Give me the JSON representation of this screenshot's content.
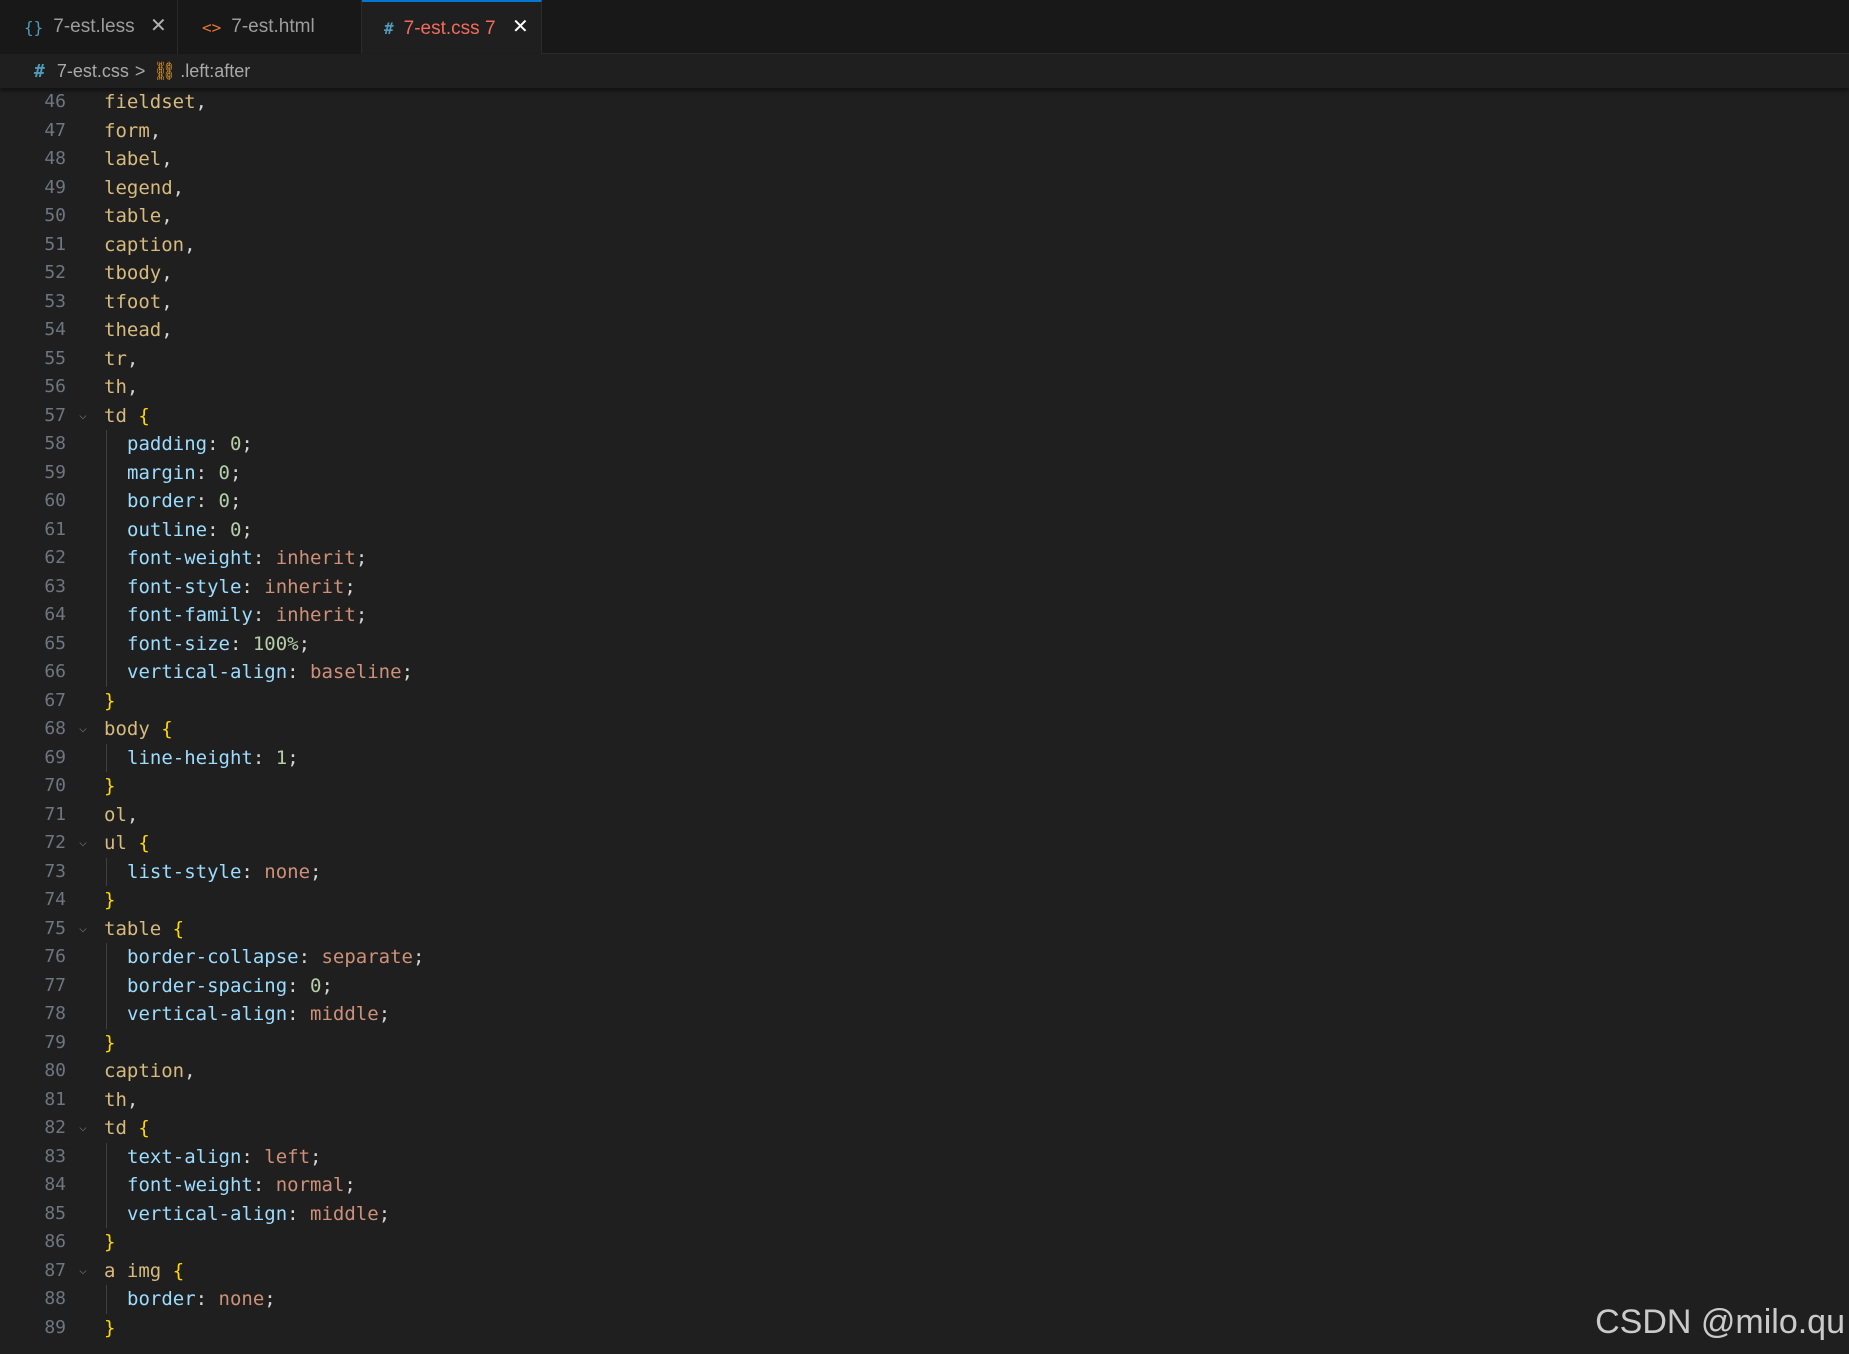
{
  "tabs": [
    {
      "icon": "{}",
      "label": "7-est.less",
      "close": "✕",
      "icon_color": "#519aba"
    },
    {
      "icon": "<>",
      "label": "7-est.html",
      "close": "",
      "icon_color": "#e37933"
    },
    {
      "icon": "#",
      "label": "7-est.css 7",
      "close": "✕",
      "icon_color": "#519aba",
      "active": true
    }
  ],
  "breadcrumb": {
    "file": "7-est.css",
    "hash": "#",
    "separator": ">",
    "symbol_icon": "⛓",
    "symbol": ".left:after"
  },
  "colors": {
    "selector": "#d7ba7d",
    "property": "#9cdcfe",
    "number": "#b5cea8",
    "keyword": "#ce9178",
    "brace": "#ffd700",
    "active_tab_text": "#f26b5b",
    "active_tab_border": "#0078d4"
  },
  "code_lines": [
    {
      "n": "46",
      "tokens": [
        [
          "sel",
          "fieldset"
        ],
        [
          "punct",
          ","
        ]
      ]
    },
    {
      "n": "47",
      "tokens": [
        [
          "sel",
          "form"
        ],
        [
          "punct",
          ","
        ]
      ]
    },
    {
      "n": "48",
      "tokens": [
        [
          "sel",
          "label"
        ],
        [
          "punct",
          ","
        ]
      ]
    },
    {
      "n": "49",
      "tokens": [
        [
          "sel",
          "legend"
        ],
        [
          "punct",
          ","
        ]
      ]
    },
    {
      "n": "50",
      "tokens": [
        [
          "sel",
          "table"
        ],
        [
          "punct",
          ","
        ]
      ]
    },
    {
      "n": "51",
      "tokens": [
        [
          "sel",
          "caption"
        ],
        [
          "punct",
          ","
        ]
      ]
    },
    {
      "n": "52",
      "tokens": [
        [
          "sel",
          "tbody"
        ],
        [
          "punct",
          ","
        ]
      ]
    },
    {
      "n": "53",
      "tokens": [
        [
          "sel",
          "tfoot"
        ],
        [
          "punct",
          ","
        ]
      ]
    },
    {
      "n": "54",
      "tokens": [
        [
          "sel",
          "thead"
        ],
        [
          "punct",
          ","
        ]
      ]
    },
    {
      "n": "55",
      "tokens": [
        [
          "sel",
          "tr"
        ],
        [
          "punct",
          ","
        ]
      ]
    },
    {
      "n": "56",
      "tokens": [
        [
          "sel",
          "th"
        ],
        [
          "punct",
          ","
        ]
      ]
    },
    {
      "n": "57",
      "fold": true,
      "tokens": [
        [
          "sel",
          "td"
        ],
        [
          "punct",
          " "
        ],
        [
          "brace",
          "{"
        ]
      ]
    },
    {
      "n": "58",
      "indent": true,
      "tokens": [
        [
          "prop",
          "padding"
        ],
        [
          "punct",
          ": "
        ],
        [
          "num",
          "0"
        ],
        [
          "punct",
          ";"
        ]
      ]
    },
    {
      "n": "59",
      "indent": true,
      "tokens": [
        [
          "prop",
          "margin"
        ],
        [
          "punct",
          ": "
        ],
        [
          "num",
          "0"
        ],
        [
          "punct",
          ";"
        ]
      ]
    },
    {
      "n": "60",
      "indent": true,
      "tokens": [
        [
          "prop",
          "border"
        ],
        [
          "punct",
          ": "
        ],
        [
          "num",
          "0"
        ],
        [
          "punct",
          ";"
        ]
      ]
    },
    {
      "n": "61",
      "indent": true,
      "tokens": [
        [
          "prop",
          "outline"
        ],
        [
          "punct",
          ": "
        ],
        [
          "num",
          "0"
        ],
        [
          "punct",
          ";"
        ]
      ]
    },
    {
      "n": "62",
      "indent": true,
      "tokens": [
        [
          "prop",
          "font-weight"
        ],
        [
          "punct",
          ": "
        ],
        [
          "kw",
          "inherit"
        ],
        [
          "punct",
          ";"
        ]
      ]
    },
    {
      "n": "63",
      "indent": true,
      "tokens": [
        [
          "prop",
          "font-style"
        ],
        [
          "punct",
          ": "
        ],
        [
          "kw",
          "inherit"
        ],
        [
          "punct",
          ";"
        ]
      ]
    },
    {
      "n": "64",
      "indent": true,
      "tokens": [
        [
          "prop",
          "font-family"
        ],
        [
          "punct",
          ": "
        ],
        [
          "kw",
          "inherit"
        ],
        [
          "punct",
          ";"
        ]
      ]
    },
    {
      "n": "65",
      "indent": true,
      "tokens": [
        [
          "prop",
          "font-size"
        ],
        [
          "punct",
          ": "
        ],
        [
          "num",
          "100%"
        ],
        [
          "punct",
          ";"
        ]
      ]
    },
    {
      "n": "66",
      "indent": true,
      "tokens": [
        [
          "prop",
          "vertical-align"
        ],
        [
          "punct",
          ": "
        ],
        [
          "kw",
          "baseline"
        ],
        [
          "punct",
          ";"
        ]
      ]
    },
    {
      "n": "67",
      "tokens": [
        [
          "brace",
          "}"
        ]
      ]
    },
    {
      "n": "68",
      "fold": true,
      "tokens": [
        [
          "sel",
          "body"
        ],
        [
          "punct",
          " "
        ],
        [
          "brace",
          "{"
        ]
      ]
    },
    {
      "n": "69",
      "indent": true,
      "tokens": [
        [
          "prop",
          "line-height"
        ],
        [
          "punct",
          ": "
        ],
        [
          "num",
          "1"
        ],
        [
          "punct",
          ";"
        ]
      ]
    },
    {
      "n": "70",
      "tokens": [
        [
          "brace",
          "}"
        ]
      ]
    },
    {
      "n": "71",
      "tokens": [
        [
          "sel",
          "ol"
        ],
        [
          "punct",
          ","
        ]
      ]
    },
    {
      "n": "72",
      "fold": true,
      "tokens": [
        [
          "sel",
          "ul"
        ],
        [
          "punct",
          " "
        ],
        [
          "brace",
          "{"
        ]
      ]
    },
    {
      "n": "73",
      "indent": true,
      "tokens": [
        [
          "prop",
          "list-style"
        ],
        [
          "punct",
          ": "
        ],
        [
          "kw",
          "none"
        ],
        [
          "punct",
          ";"
        ]
      ]
    },
    {
      "n": "74",
      "tokens": [
        [
          "brace",
          "}"
        ]
      ]
    },
    {
      "n": "75",
      "fold": true,
      "tokens": [
        [
          "sel",
          "table"
        ],
        [
          "punct",
          " "
        ],
        [
          "brace",
          "{"
        ]
      ]
    },
    {
      "n": "76",
      "indent": true,
      "tokens": [
        [
          "prop",
          "border-collapse"
        ],
        [
          "punct",
          ": "
        ],
        [
          "kw",
          "separate"
        ],
        [
          "punct",
          ";"
        ]
      ]
    },
    {
      "n": "77",
      "indent": true,
      "tokens": [
        [
          "prop",
          "border-spacing"
        ],
        [
          "punct",
          ": "
        ],
        [
          "num",
          "0"
        ],
        [
          "punct",
          ";"
        ]
      ]
    },
    {
      "n": "78",
      "indent": true,
      "tokens": [
        [
          "prop",
          "vertical-align"
        ],
        [
          "punct",
          ": "
        ],
        [
          "kw",
          "middle"
        ],
        [
          "punct",
          ";"
        ]
      ]
    },
    {
      "n": "79",
      "tokens": [
        [
          "brace",
          "}"
        ]
      ]
    },
    {
      "n": "80",
      "tokens": [
        [
          "sel",
          "caption"
        ],
        [
          "punct",
          ","
        ]
      ]
    },
    {
      "n": "81",
      "tokens": [
        [
          "sel",
          "th"
        ],
        [
          "punct",
          ","
        ]
      ]
    },
    {
      "n": "82",
      "fold": true,
      "tokens": [
        [
          "sel",
          "td"
        ],
        [
          "punct",
          " "
        ],
        [
          "brace",
          "{"
        ]
      ]
    },
    {
      "n": "83",
      "indent": true,
      "tokens": [
        [
          "prop",
          "text-align"
        ],
        [
          "punct",
          ": "
        ],
        [
          "kw",
          "left"
        ],
        [
          "punct",
          ";"
        ]
      ]
    },
    {
      "n": "84",
      "indent": true,
      "tokens": [
        [
          "prop",
          "font-weight"
        ],
        [
          "punct",
          ": "
        ],
        [
          "kw",
          "normal"
        ],
        [
          "punct",
          ";"
        ]
      ]
    },
    {
      "n": "85",
      "indent": true,
      "tokens": [
        [
          "prop",
          "vertical-align"
        ],
        [
          "punct",
          ": "
        ],
        [
          "kw",
          "middle"
        ],
        [
          "punct",
          ";"
        ]
      ]
    },
    {
      "n": "86",
      "tokens": [
        [
          "brace",
          "}"
        ]
      ]
    },
    {
      "n": "87",
      "fold": true,
      "tokens": [
        [
          "sel",
          "a"
        ],
        [
          "punct",
          " "
        ],
        [
          "sel",
          "img"
        ],
        [
          "punct",
          " "
        ],
        [
          "brace",
          "{"
        ]
      ]
    },
    {
      "n": "88",
      "indent": true,
      "tokens": [
        [
          "prop",
          "border"
        ],
        [
          "punct",
          ": "
        ],
        [
          "kw",
          "none"
        ],
        [
          "punct",
          ";"
        ]
      ]
    },
    {
      "n": "89",
      "tokens": [
        [
          "brace",
          "}"
        ]
      ]
    }
  ],
  "fold_icon": "⌵",
  "watermark": "CSDN @milo.qu"
}
